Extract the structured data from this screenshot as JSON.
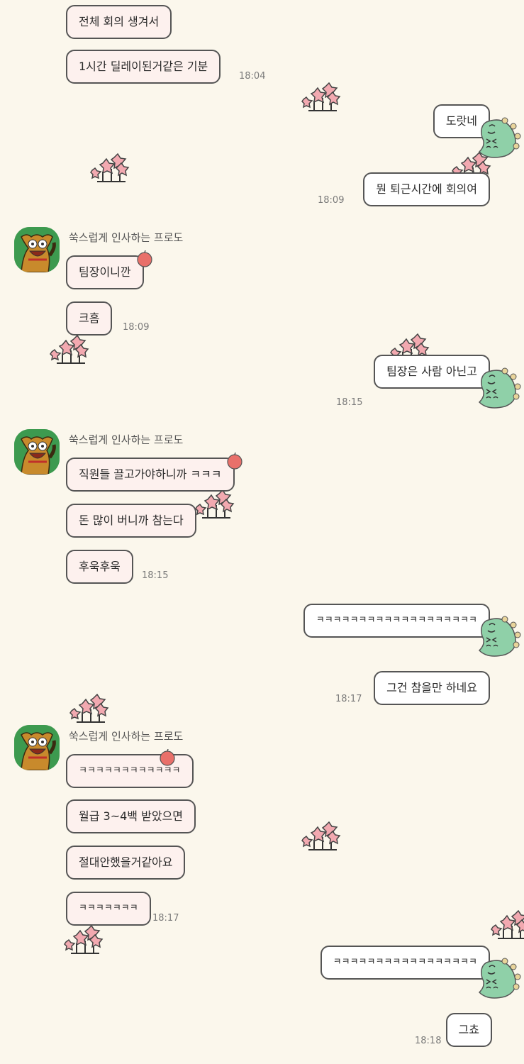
{
  "chat": {
    "friend_name": "쑥스럽게 인사하는 프로도",
    "messages": [
      {
        "side": "left",
        "text": "전체 회의 생겨서"
      },
      {
        "side": "left",
        "text": "1시간 딜레이된거같은 기분",
        "time": "18:04"
      },
      {
        "side": "right",
        "text": "도랏네"
      },
      {
        "side": "right",
        "text": "뭔 퇴근시간에 회의여",
        "time": "18:09"
      },
      {
        "side": "left",
        "text": "팀장이니깐"
      },
      {
        "side": "left",
        "text": "크흠",
        "time": "18:09"
      },
      {
        "side": "right",
        "text": "팀장은 사람 아닌고",
        "time": "18:15"
      },
      {
        "side": "left",
        "text": "직원들 끌고가야하니까 ㅋㅋㅋ"
      },
      {
        "side": "left",
        "text": "돈 많이 버니까 참는다"
      },
      {
        "side": "left",
        "text": "후욱후욱",
        "time": "18:15"
      },
      {
        "side": "right",
        "text": "ㅋㅋㅋㅋㅋㅋㅋㅋㅋㅋㅋㅋㅋㅋㅋㅋㅋㅋㅋ"
      },
      {
        "side": "right",
        "text": "그건 참을만 하네요",
        "time": "18:17"
      },
      {
        "side": "left",
        "text": "ㅋㅋㅋㅋㅋㅋㅋㅋㅋㅋㅋㅋ"
      },
      {
        "side": "left",
        "text": "월급 3~4백 받았으면"
      },
      {
        "side": "left",
        "text": "절대안했을거같아요"
      },
      {
        "side": "left",
        "text": "ㅋㅋㅋㅋㅋㅋㅋ",
        "time": "18:17"
      },
      {
        "side": "right",
        "text": "ㅋㅋㅋㅋㅋㅋㅋㅋㅋㅋㅋㅋㅋㅋㅋㅋㅋ"
      },
      {
        "side": "right",
        "text": "그쵸",
        "time": "18:18"
      }
    ]
  },
  "colors": {
    "background": "#fbf7ec",
    "left_bubble": "#fdf1ee",
    "right_bubble": "#ffffff",
    "avatar_bg": "#3d9a4f"
  },
  "icons": {
    "avatar": "frodo-dog-avatar",
    "sticker_flower": "pink-flower-sticker",
    "sticker_dino": "green-dino-sticker",
    "sticker_apple": "apple-sticker"
  }
}
